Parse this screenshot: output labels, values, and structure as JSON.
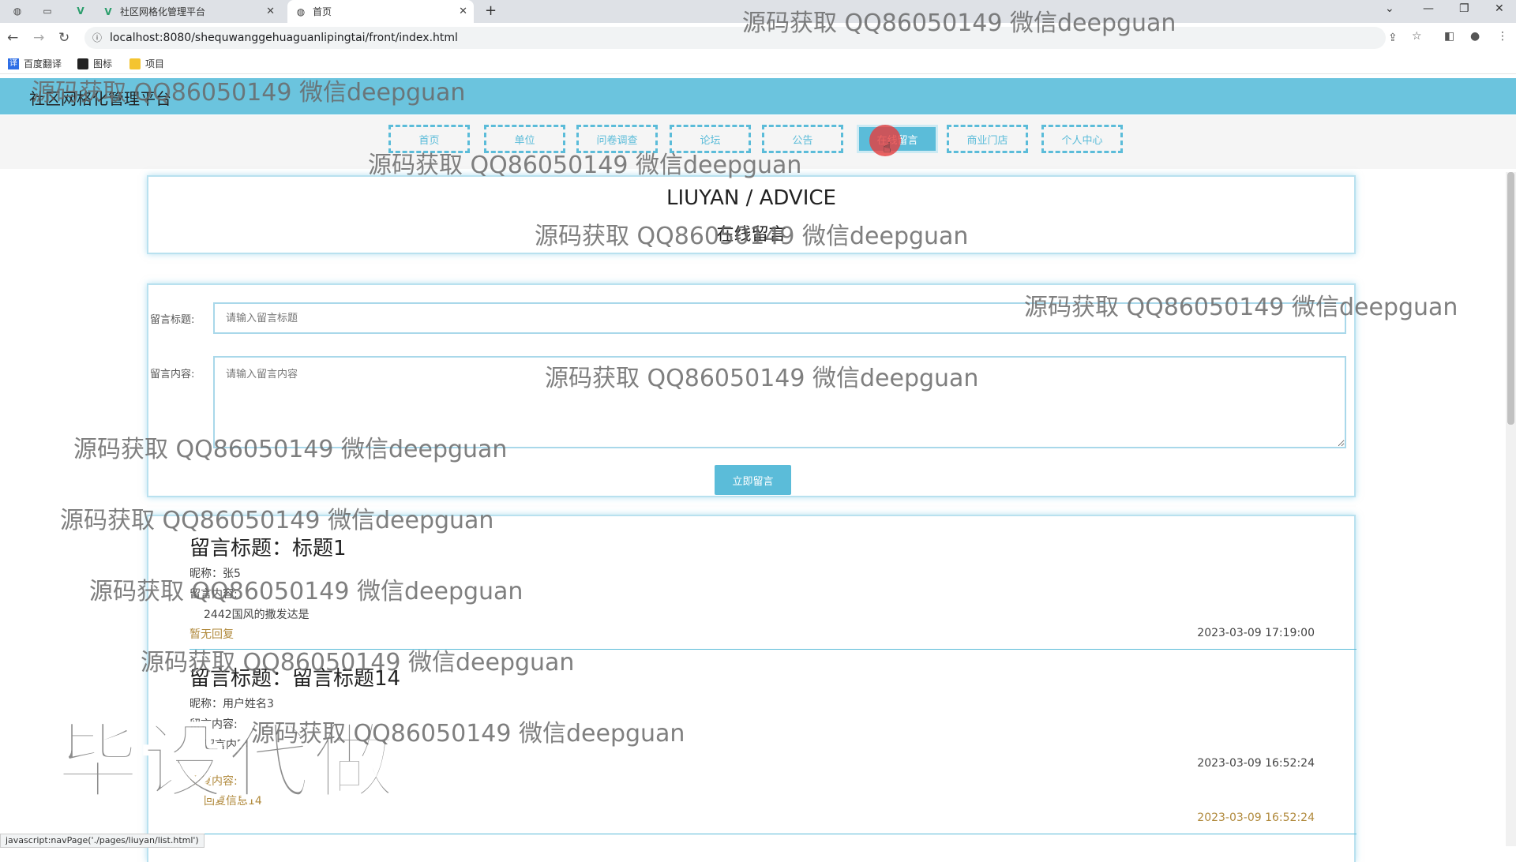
{
  "browser": {
    "tabs": [
      {
        "title": "社区网格化管理平台",
        "icon": "vue-v-icon"
      },
      {
        "title": "首页",
        "icon": "globe-icon"
      }
    ],
    "url": "localhost:8080/shequwanggehuaguanlipingtai/front/index.html",
    "bookmarks": [
      {
        "label": "百度翻译",
        "icon": "translate-icon"
      },
      {
        "label": "图标",
        "icon": "icon-page-icon"
      },
      {
        "label": "项目",
        "icon": "folder-icon"
      }
    ],
    "status_url": "javascript:navPage('./pages/liuyan/list.html')"
  },
  "site": {
    "title": "社区网格化管理平台",
    "nav": [
      "首页",
      "单位",
      "问卷调查",
      "论坛",
      "公告",
      "在线留言",
      "商业门店",
      "个人中心"
    ],
    "active_nav": "在线留言"
  },
  "page": {
    "heading_en": "LIUYAN / ADVICE",
    "heading_cn": "在线留言"
  },
  "form": {
    "title_label": "留言标题:",
    "title_placeholder": "请输入留言标题",
    "content_label": "留言内容:",
    "content_placeholder": "请输入留言内容",
    "submit_label": "立即留言"
  },
  "messages": [
    {
      "title": "留言标题：标题1",
      "nickname": "昵称：张5",
      "content_label": "留言内容:",
      "content": "2442国风的撒发达是",
      "reply": "暂无回复",
      "time": "2023-03-09 17:19:00"
    },
    {
      "title": "留言标题：留言标题14",
      "nickname": "昵称：用户姓名3",
      "content_label": "留言内容:",
      "content": "留言内容1",
      "reply_label": "回复内容:",
      "reply_content": "回复信息14",
      "time": "2023-03-09 16:52:24",
      "reply_time": "2023-03-09 16:52:24"
    }
  ],
  "watermark": {
    "text": "源码获取 QQ86050149 微信deepguan",
    "big": "毕设代做"
  }
}
